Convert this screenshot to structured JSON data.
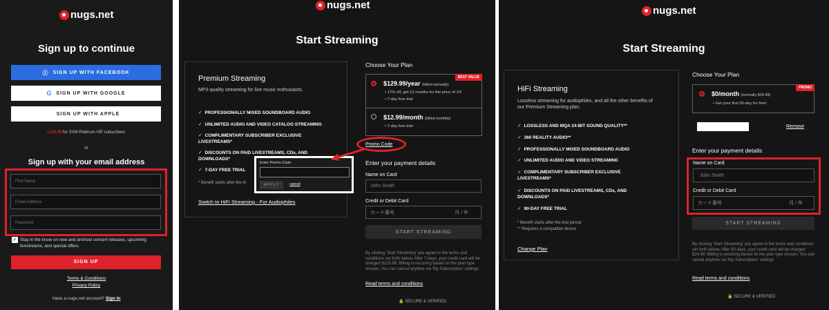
{
  "brand": {
    "name": "nugs.net",
    "accent": "#e0222b"
  },
  "signup": {
    "title": "Sign up to continue",
    "facebook": "SIGN UP WITH FACEBOOK",
    "google": "SIGN UP WITH GOOGLE",
    "apple": "SIGN UP WITH APPLE",
    "login_link": "LOG IN",
    "login_text": "for SXM Platinum VIP subscribers",
    "or": "or",
    "email_heading": "Sign up with your email address",
    "first_name_placeholder": "First Name",
    "email_placeholder": "Email Address",
    "password_placeholder": "Password",
    "newsletter_text": "Stay in the know on new and archival concert releases, upcoming livestreams, and special offers.",
    "signup_button": "SIGN UP",
    "terms": "Terms & Conditions",
    "privacy": "Privacy Policy",
    "have_account": "Have a nugs.net account?",
    "signin": "Sign In"
  },
  "streaming1": {
    "title": "Start Streaming",
    "plan_name": "Premium Streaming",
    "plan_desc": "MP3-quality streaming for live music enthusiasts.",
    "features": [
      "PROFESSIONALLY MIXED SOUNDBOARD AUDIO",
      "UNLIMITED AUDIO AND VIDEO CATALOG STREAMING",
      "COMPLIMENTARY SUBSCRIBER EXCLUSIVE LIVESTREAMS*",
      "DISCOUNTS ON PAID LIVESTREAMS, CDs, AND DOWNLOADS*",
      "7-DAY FREE TRIAL"
    ],
    "benefit_note": "* Benefit starts after the tri",
    "switch_link": "Switch to HiFi Streaming - For Audiophiles",
    "choose_plan": "Choose Your Plan",
    "best_value": "BEST VALUE",
    "yearly_price": "$129.99/year",
    "yearly_note": "(billed annually)",
    "yearly_bullets": [
      "17% off, get 12 months for the price of 10!",
      "7-day free trial"
    ],
    "monthly_price": "$12.99/month",
    "monthly_note": "(billed monthly)",
    "monthly_bullets": [
      "7-day free trial"
    ],
    "promo_link": "Promo Code",
    "promo_label": "Enter Promo Code",
    "apply": "APPLY",
    "cancel": "cancel",
    "payment_heading": "Enter your payment details",
    "name_label": "Name on Card",
    "name_placeholder": "John Smith",
    "card_label": "Credit or Debit Card",
    "card_placeholder": "カード番号",
    "card_date": "月 / 年",
    "start_button": "START STREAMING",
    "legal": "By clicking 'Start Streaming' you agree to the terms and conditions set forth below. After 7-days, your credit card will be charged $129.99. Billing is recurring based on the plan type chosen. You can cancel anytime via 'My Subscription' settings",
    "read_terms": "Read terms and conditions",
    "secure": "SECURE & VERIFIED"
  },
  "streaming2": {
    "title": "Start Streaming",
    "plan_name": "HiFi Streaming",
    "plan_desc": "Lossless streaming for audiophiles, and all the other benefits of our Premium Streaming plan.",
    "features": [
      "LOSSLESS AND MQA 24-BIT SOUND QUALITY**",
      "360 REALITY AUDIO**",
      "PROFESSIONALLY MIXED SOUNDBOARD AUDIO",
      "UNLIMITED AUDIO AND VIDEO STREAMING",
      "COMPLIMENTARY SUBSCRIBER EXCLUSIVE LIVESTREAMS*",
      "DISCOUNTS ON PAID LIVESTREAMS, CDs, AND DOWNLOADS*",
      "90-DAY FREE TRIAL"
    ],
    "note1": "* Benefit starts after the trial period",
    "note2": "** Requires a compatible device",
    "change_plan": "Change Plan",
    "choose_plan": "Choose Your Plan",
    "promo_badge": "PROMO",
    "price": "$0/month",
    "price_note": "(normally $24.99)",
    "bullet": "Get your first 90-day for free!",
    "remove": "Remove",
    "payment_heading": "Enter your payment details",
    "name_label": "Name on Card",
    "name_placeholder": "John Smith",
    "card_label": "Credit or Debit Card",
    "card_placeholder": "カード番号",
    "card_date": "月 / 年",
    "start_button": "START STREAMING",
    "legal": "By clicking 'Start Streaming' you agree to the terms and conditions set forth below. After 90-days, your credit card will be charged $24.99. Billing is recurring based on the plan type chosen. You can cancel anytime via 'My Subscription' settings",
    "read_terms": "Read terms and conditions",
    "secure": "SECURE & VERIFIED"
  }
}
